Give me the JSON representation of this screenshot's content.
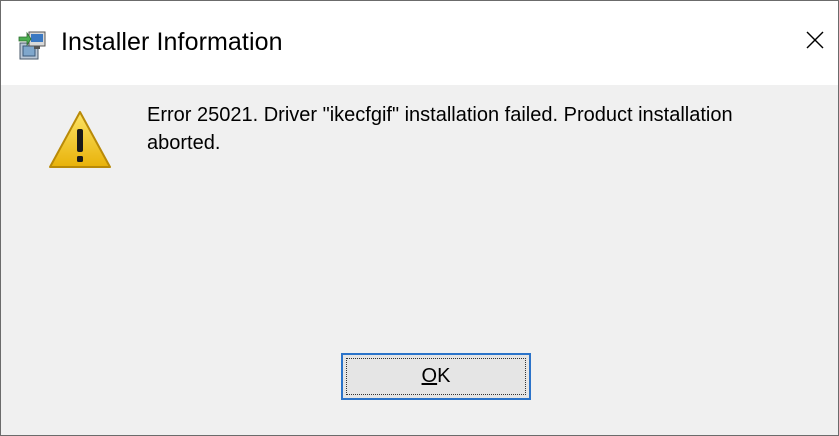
{
  "window": {
    "title": "Installer Information",
    "app_icon": "installer-package-icon",
    "close_icon": "close-icon"
  },
  "content": {
    "icon": "warning-icon",
    "message": "Error 25021. Driver \"ikecfgif\" installation failed. Product installation aborted."
  },
  "buttons": {
    "ok_mnemonic": "O",
    "ok_rest": "K"
  },
  "colors": {
    "titlebar_bg": "#ffffff",
    "dialog_bg": "#f0f0f0",
    "button_focus_border": "#2b73c9",
    "warning_yellow": "#f2c81c"
  }
}
